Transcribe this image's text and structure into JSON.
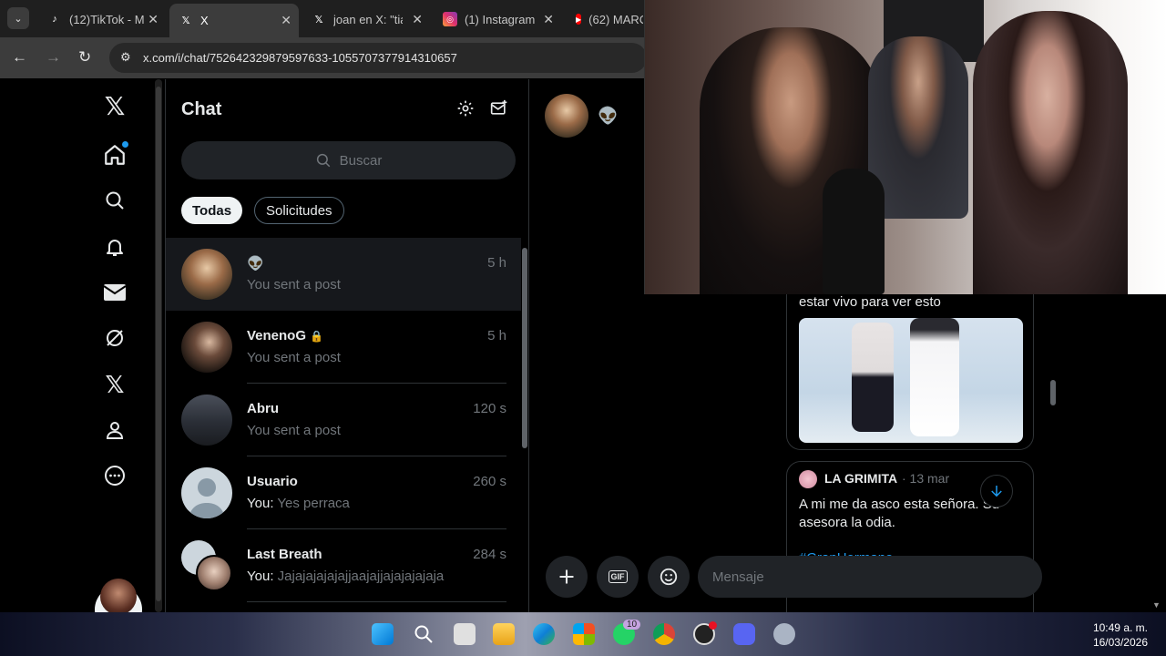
{
  "browser": {
    "tabs": [
      {
        "title": "(12)TikTok - M",
        "icon": "tiktok-icon",
        "active": false
      },
      {
        "title": "X",
        "icon": "x-logo-icon",
        "active": true
      },
      {
        "title": "joan en X: \"tia",
        "icon": "x-logo-icon",
        "active": false
      },
      {
        "title": "(1) Instagram",
        "icon": "instagram-icon",
        "active": false
      },
      {
        "title": "(62) MARC",
        "icon": "youtube-icon",
        "active": false
      }
    ],
    "url": "x.com/i/chat/752642329879597633-1055707377914310657"
  },
  "chat": {
    "title": "Chat",
    "search_placeholder": "Buscar",
    "filters": [
      "Todas",
      "Solicitudes"
    ],
    "conversations": [
      {
        "name": "👽",
        "time": "5 h",
        "preview": "You sent a post",
        "lock": false
      },
      {
        "name": "VenenoG",
        "time": "5 h",
        "preview": "You sent a post",
        "lock": true
      },
      {
        "name": "Abru",
        "time": "120 s",
        "preview": "You sent a post",
        "lock": false
      },
      {
        "name": "Usuario",
        "time": "260 s",
        "preview_prefix": "You:",
        "preview": "Yes perraca",
        "lock": false
      },
      {
        "name": "Last Breath",
        "time": "284 s",
        "preview_prefix": "You:",
        "preview": "Jajajajajajajjaajajjajajajajaja",
        "lock": false
      }
    ]
  },
  "conversation": {
    "header_emoji": "👽",
    "post1_caption": "estar vivo para ver esto",
    "post2": {
      "author": "LA GRIMITA",
      "date": "· 13 mar",
      "text_line1": "A mi me da asco esta señora. Su",
      "text_line2": "asesora la odia.",
      "hashtag": "#GranHermano"
    },
    "composer_placeholder": "Mensaje",
    "gif_label": "GIF"
  },
  "taskbar": {
    "time": "10:49 a. m.",
    "date": "16/03/2026",
    "whatsapp_badge": "10"
  },
  "colors": {
    "x_background": "#000000",
    "border": "#2f3336",
    "muted_text": "#71767b",
    "accent_blue": "#1d9bf0"
  }
}
